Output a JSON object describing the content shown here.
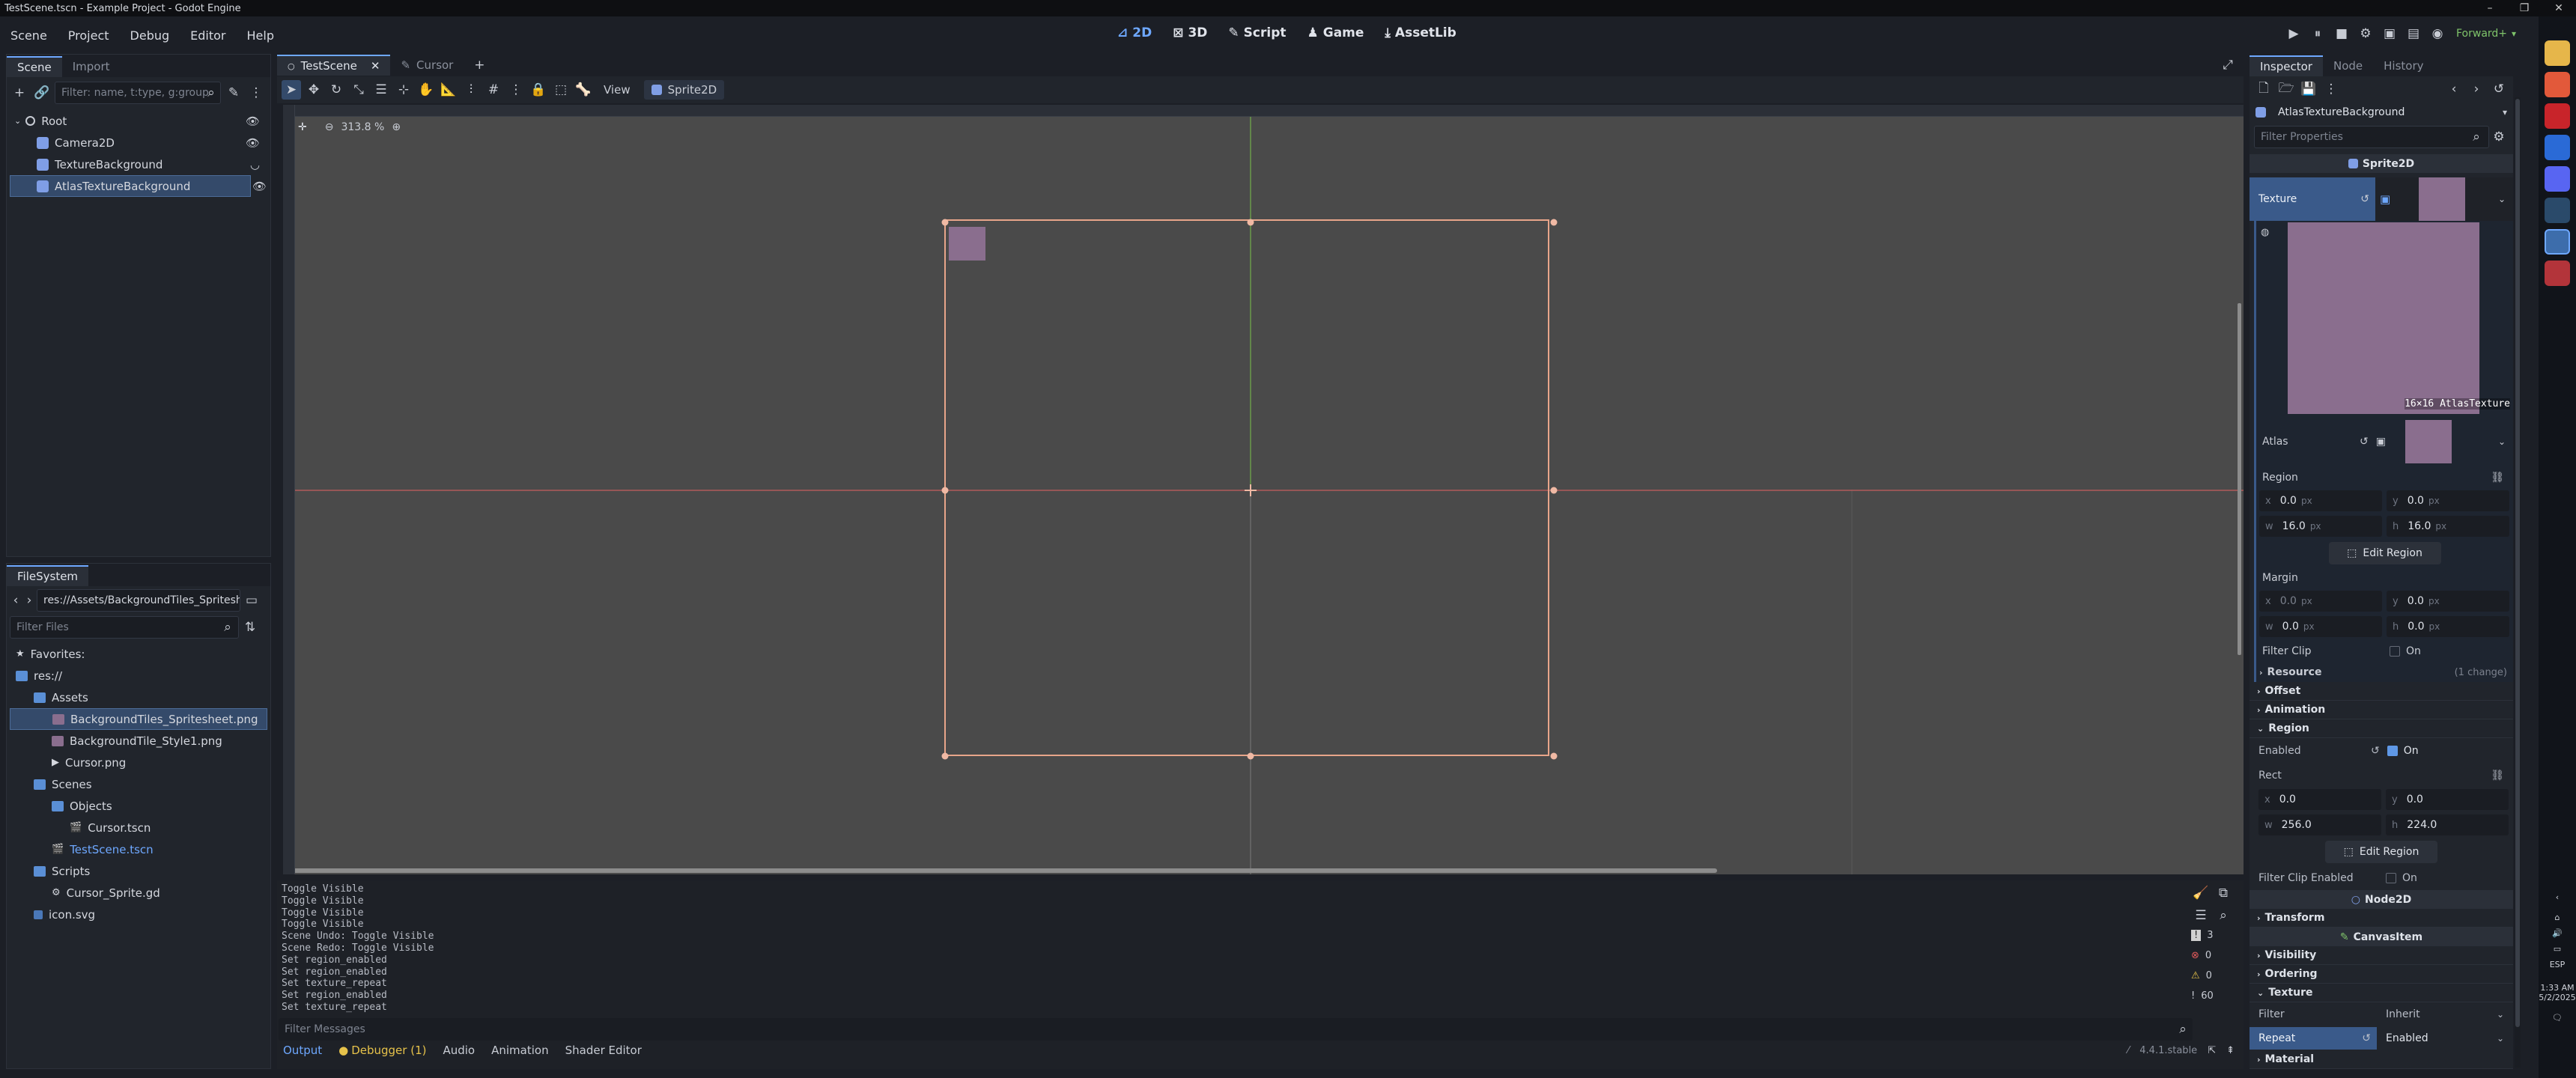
{
  "window": {
    "title": "TestScene.tscn - Example Project - Godot Engine",
    "controls": [
      "–",
      "❐",
      "✕"
    ]
  },
  "menubar": {
    "items": [
      "Scene",
      "Project",
      "Debug",
      "Editor",
      "Help"
    ],
    "workspaces": [
      {
        "label": "2D",
        "active": true
      },
      {
        "label": "3D",
        "active": false
      },
      {
        "label": "Script",
        "active": false
      },
      {
        "label": "Game",
        "active": false
      },
      {
        "label": "AssetLib",
        "active": false
      }
    ],
    "renderer": "Forward+"
  },
  "scene_dock": {
    "tabs": [
      "Scene",
      "Import"
    ],
    "filter_placeholder": "Filter: name, t:type, g:group",
    "nodes": [
      {
        "label": "Root",
        "depth": 0,
        "eye": "visible"
      },
      {
        "label": "Camera2D",
        "depth": 1,
        "eye": "visible"
      },
      {
        "label": "TextureBackground",
        "depth": 1,
        "eye": "hidden"
      },
      {
        "label": "AtlasTextureBackground",
        "depth": 1,
        "eye": "visible",
        "selected": true
      }
    ]
  },
  "filesystem": {
    "title": "FileSystem",
    "path": "res://Assets/BackgroundTiles_Spritesheet.png",
    "filter_placeholder": "Filter Files",
    "items": [
      {
        "label": "Favorites:",
        "depth": 0,
        "kind": "star"
      },
      {
        "label": "res://",
        "depth": 0,
        "kind": "folder"
      },
      {
        "label": "Assets",
        "depth": 1,
        "kind": "folder"
      },
      {
        "label": "BackgroundTiles_Spritesheet.png",
        "depth": 2,
        "kind": "image",
        "selected": true
      },
      {
        "label": "BackgroundTile_Style1.png",
        "depth": 2,
        "kind": "image"
      },
      {
        "label": "Cursor.png",
        "depth": 2,
        "kind": "cursor"
      },
      {
        "label": "Scenes",
        "depth": 1,
        "kind": "folder"
      },
      {
        "label": "Objects",
        "depth": 2,
        "kind": "folder"
      },
      {
        "label": "Cursor.tscn",
        "depth": 3,
        "kind": "scene"
      },
      {
        "label": "TestScene.tscn",
        "depth": 2,
        "kind": "scene",
        "highlight": true
      },
      {
        "label": "Scripts",
        "depth": 1,
        "kind": "folder"
      },
      {
        "label": "Cursor_Sprite.gd",
        "depth": 2,
        "kind": "script"
      },
      {
        "label": "icon.svg",
        "depth": 1,
        "kind": "svg"
      }
    ]
  },
  "editor_tabs": [
    {
      "label": "TestScene",
      "active": true
    },
    {
      "label": "Cursor",
      "active": false
    }
  ],
  "viewport_toolbar": {
    "view_label": "View",
    "sprite_label": "Sprite2D",
    "zoom": "313.8 %"
  },
  "output": {
    "lines": [
      "Toggle Visible",
      "Toggle Visible",
      "Toggle Visible",
      "Toggle Visible",
      "Scene Undo: Toggle Visible",
      "Scene Redo: Toggle Visible",
      "Set region_enabled",
      "Set region_enabled",
      "Set texture_repeat",
      "Set region_enabled",
      "Set texture_repeat"
    ],
    "filter_placeholder": "Filter Messages",
    "counts": [
      "3",
      "0",
      "0",
      "60"
    ],
    "bottom_tabs": [
      "Output",
      "Debugger (1)",
      "Audio",
      "Animation",
      "Shader Editor"
    ],
    "version": "4.4.1.stable"
  },
  "inspector": {
    "tabs": [
      "Inspector",
      "Node",
      "History"
    ],
    "object_name": "AtlasTextureBackground",
    "filter_placeholder": "Filter Properties",
    "sprite_category": "Sprite2D",
    "texture_label": "Texture",
    "preview_caption": "16×16 AtlasTexture",
    "atlas_label": "Atlas",
    "region_label": "Region",
    "region": {
      "x": "0.0",
      "y": "0.0",
      "w": "16.0",
      "h": "16.0",
      "unit": "px"
    },
    "edit_region": "Edit Region",
    "margin_label": "Margin",
    "margin": {
      "x": "0.0",
      "y": "0.0",
      "w": "0.0",
      "h": "0.0",
      "unit": "px"
    },
    "filter_clip_label": "Filter Clip",
    "on_label": "On",
    "resource_label": "Resource",
    "resource_change": "(1 change)",
    "sections": {
      "offset": "Offset",
      "animation": "Animation",
      "region": "Region"
    },
    "enabled_label": "Enabled",
    "rect_label": "Rect",
    "rect": {
      "x": "0.0",
      "y": "0.0",
      "w": "256.0",
      "h": "224.0"
    },
    "filter_clip_enabled_label": "Filter Clip Enabled",
    "node2d_category": "Node2D",
    "transform": "Transform",
    "canvasitem_category": "CanvasItem",
    "visibility": "Visibility",
    "ordering": "Ordering",
    "texture_section": "Texture",
    "filter_prop": "Filter",
    "filter_value": "Inherit",
    "repeat_prop": "Repeat",
    "repeat_value": "Enabled",
    "material": "Material"
  },
  "taskbar": {
    "lang": "ESP",
    "time": "1:33 AM",
    "date": "5/2/2025"
  }
}
